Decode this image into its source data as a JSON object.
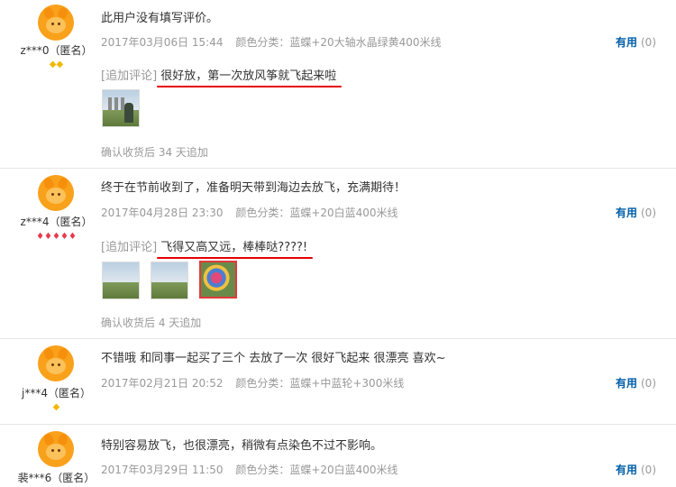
{
  "helpful_label": "有用",
  "append_tag": "[追加评论]",
  "badge_gold_icon": "◆",
  "badge_red_icon": "♦",
  "colors": {
    "link": "#005ea7",
    "underline": "#e60000",
    "meta": "#999999",
    "avatar": "#f9a11b"
  },
  "reviews": [
    {
      "user": "z***0（匿名）",
      "comment": "此用户没有填写评价。",
      "date": "2017年03月06日 15:44",
      "sku": "颜色分类：蓝蝶+20大轴水晶绿黄400米线",
      "helpful_count": "(0)",
      "append_text": "很好放，第一次放风筝就飞起来啦",
      "confirm": "确认收货后 34 天追加",
      "badges": "◆◆"
    },
    {
      "user": "z***4（匿名）",
      "comment": "终于在节前收到了，准备明天带到海边去放飞，充满期待！",
      "date": "2017年04月28日 23:30",
      "sku": "颜色分类：蓝蝶+20白蓝400米线",
      "helpful_count": "(0)",
      "append_text": "飞得又高又远，棒棒哒????!",
      "confirm": "确认收货后 4 天追加",
      "badges": "♦♦♦♦♦"
    },
    {
      "user": "j***4（匿名）",
      "comment": "不错哦 和同事一起买了三个 去放了一次 很好飞起来 很漂亮 喜欢~",
      "date": "2017年02月21日 20:52",
      "sku": "颜色分类：蓝蝶+中蓝轮+300米线",
      "helpful_count": "(0)",
      "badges": "◆"
    },
    {
      "user": "裴***6（匿名）",
      "comment": "特别容易放飞，也很漂亮，稍微有点染色不过不影响。",
      "date": "2017年03月29日 11:50",
      "sku": "颜色分类：蓝蝶+20白蓝400米线",
      "helpful_count": "(0)"
    }
  ]
}
